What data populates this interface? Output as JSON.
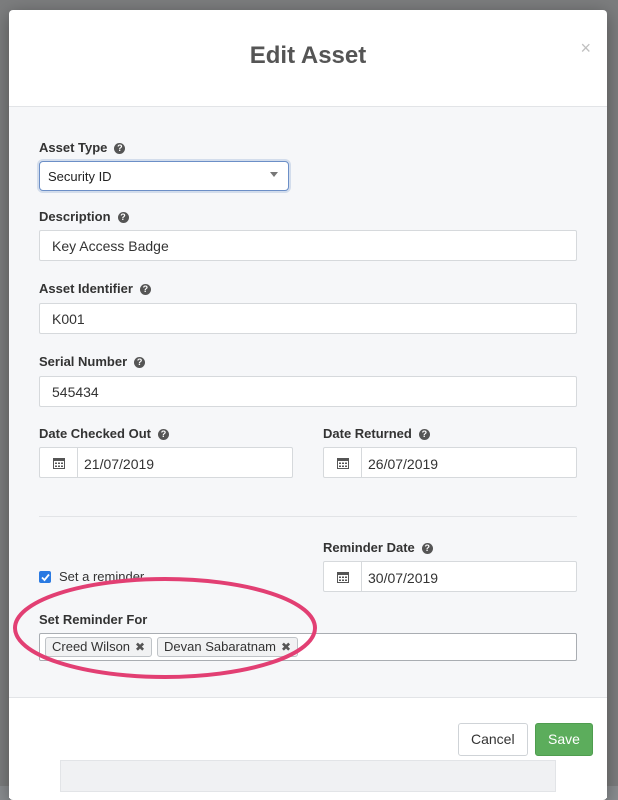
{
  "modal": {
    "title": "Edit Asset",
    "close_glyph": "×"
  },
  "form": {
    "asset_type": {
      "label": "Asset Type",
      "value": "Security ID"
    },
    "description": {
      "label": "Description",
      "value": "Key Access Badge"
    },
    "asset_identifier": {
      "label": "Asset Identifier",
      "value": "K001"
    },
    "serial_number": {
      "label": "Serial Number",
      "value": "545434"
    },
    "date_checked_out": {
      "label": "Date Checked Out",
      "value": "21/07/2019"
    },
    "date_returned": {
      "label": "Date Returned",
      "value": "26/07/2019"
    },
    "set_reminder": {
      "label": "Set a reminder",
      "checked": true
    },
    "reminder_date": {
      "label": "Reminder Date",
      "value": "30/07/2019"
    },
    "reminder_for": {
      "label": "Set Reminder For",
      "tags": [
        "Creed Wilson",
        "Devan Sabaratnam"
      ]
    },
    "help_glyph": "?"
  },
  "footer": {
    "cancel_label": "Cancel",
    "save_label": "Save"
  },
  "annotation": {
    "color": "#e23f73"
  },
  "colors": {
    "accent_blue": "#2a7ae2",
    "save_green": "#5cad5c"
  }
}
